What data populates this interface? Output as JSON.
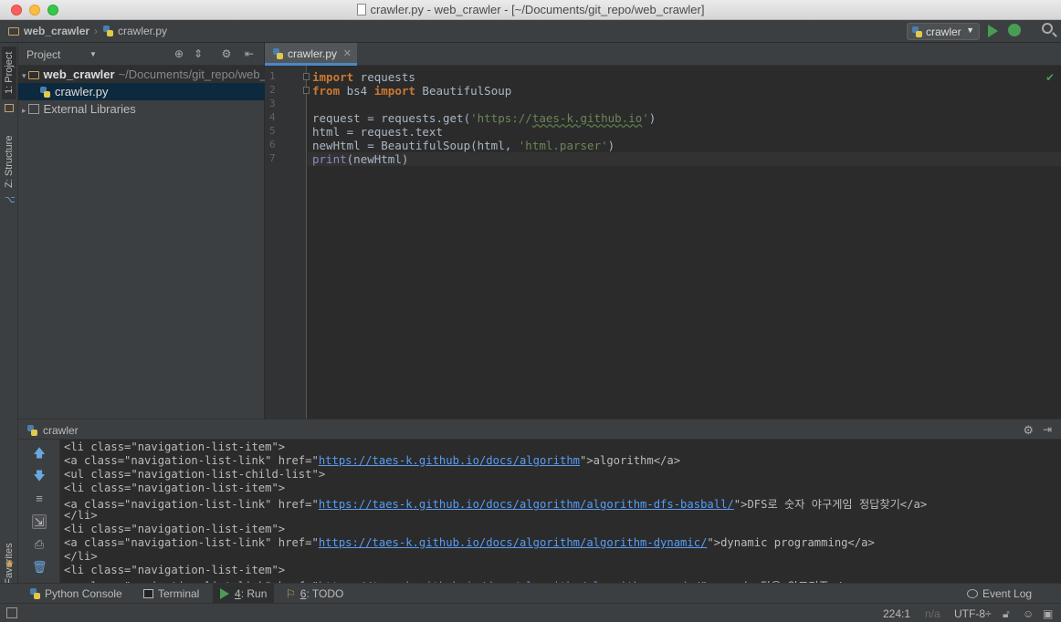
{
  "window": {
    "title": "crawler.py - web_crawler - [~/Documents/git_repo/web_crawler]"
  },
  "navbar": {
    "project": "web_crawler",
    "file": "crawler.py",
    "run_config": "crawler"
  },
  "left_stripe": {
    "project_tab": "1: Project",
    "structure_tab": "Z: Structure",
    "favorites_tab": "2: Favorites"
  },
  "project_panel": {
    "title": "Project",
    "root_name": "web_crawler",
    "root_path": "~/Documents/git_repo/web_crawler",
    "file": "crawler.py",
    "external_libraries": "External Libraries"
  },
  "editor": {
    "tab": "crawler.py",
    "lines": [
      {
        "n": "1",
        "parts": [
          [
            "kw",
            "import"
          ],
          [
            "",
            " requests"
          ]
        ]
      },
      {
        "n": "2",
        "parts": [
          [
            "kw",
            "from"
          ],
          [
            "",
            " bs4 "
          ],
          [
            "kw",
            "import"
          ],
          [
            "",
            " BeautifulSoup"
          ]
        ]
      },
      {
        "n": "3",
        "parts": []
      },
      {
        "n": "4",
        "parts": [
          [
            "",
            "request = requests.get("
          ],
          [
            "str",
            "'https://"
          ],
          [
            "url",
            "taes-k.github.io"
          ],
          [
            "str",
            "'"
          ],
          [
            "",
            ")"
          ]
        ]
      },
      {
        "n": "5",
        "parts": [
          [
            "",
            "html = request.text"
          ]
        ]
      },
      {
        "n": "6",
        "parts": [
          [
            "",
            "newHtml = BeautifulSoup(html, "
          ],
          [
            "str",
            "'html.parser'"
          ],
          [
            "",
            ")"
          ]
        ]
      },
      {
        "n": "7",
        "parts": [
          [
            "bi",
            "print"
          ],
          [
            "",
            "(newHtml)"
          ]
        ]
      }
    ]
  },
  "run_window": {
    "title": "crawler",
    "console": [
      {
        "parts": [
          [
            "",
            "<li class=\"navigation-list-item\">"
          ]
        ]
      },
      {
        "parts": [
          [
            "",
            "<a class=\"navigation-list-link\" href=\""
          ],
          [
            "link",
            "https://taes-k.github.io/docs/algorithm"
          ],
          [
            "",
            "\">algorithm</a>"
          ]
        ]
      },
      {
        "parts": [
          [
            "",
            "<ul class=\"navigation-list-child-list\">"
          ]
        ]
      },
      {
        "parts": [
          [
            "",
            "<li class=\"navigation-list-item\">"
          ]
        ]
      },
      {
        "parts": [
          [
            "",
            "<a class=\"navigation-list-link\" href=\""
          ],
          [
            "link",
            "https://taes-k.github.io/docs/algorithm/algorithm-dfs-basball/"
          ],
          [
            "",
            "\">DFS로 숫자 야구게임 정답찾기</a>"
          ]
        ]
      },
      {
        "parts": [
          [
            "",
            "</li>"
          ]
        ]
      },
      {
        "parts": [
          [
            "",
            "<li class=\"navigation-list-item\">"
          ]
        ]
      },
      {
        "parts": [
          [
            "",
            "<a class=\"navigation-list-link\" href=\""
          ],
          [
            "link",
            "https://taes-k.github.io/docs/algorithm/algorithm-dynamic/"
          ],
          [
            "",
            "\">dynamic programming</a>"
          ]
        ]
      },
      {
        "parts": [
          [
            "",
            "</li>"
          ]
        ]
      },
      {
        "parts": [
          [
            "",
            "<li class=\"navigation-list-item\">"
          ]
        ]
      },
      {
        "parts": [
          [
            "",
            "<a class=\"navigation-list-link\" href=\""
          ],
          [
            "link",
            "https://taes-k.github.io/docs/algorithm/algorithm-greedy/"
          ],
          [
            "",
            "\">greedy 탐욕 알고리즘</a>"
          ]
        ]
      }
    ]
  },
  "bottom_tabs": {
    "python_console": "Python Console",
    "terminal": "Terminal",
    "run_num": "4",
    "run_label": ": Run",
    "todo_num": "6",
    "todo_label": ": TODO",
    "event_log": "Event Log"
  },
  "statusbar": {
    "position": "224:1",
    "line_sep": "n/a",
    "encoding": "UTF-8÷"
  }
}
